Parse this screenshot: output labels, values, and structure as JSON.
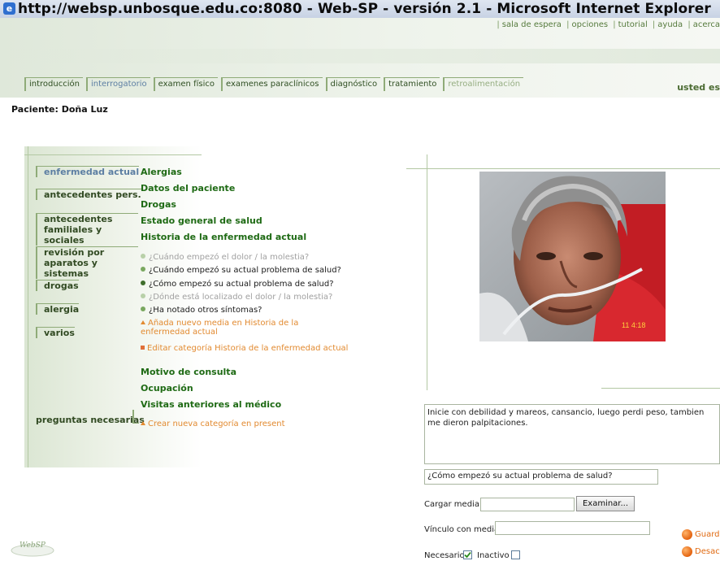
{
  "window": {
    "title": "http://websp.unbosque.edu.co:8080 - Web-SP - versión 2.1 - Microsoft Internet Explorer"
  },
  "topnav": [
    "sala de espera",
    "opciones",
    "tutorial",
    "ayuda",
    "acerca"
  ],
  "tabs": [
    {
      "label": "introducción",
      "state": "normal"
    },
    {
      "label": "interrogatorio",
      "state": "active"
    },
    {
      "label": "examen físico",
      "state": "normal"
    },
    {
      "label": "examenes paraclínicos",
      "state": "normal"
    },
    {
      "label": "diagnóstico",
      "state": "normal"
    },
    {
      "label": "tratamiento",
      "state": "normal"
    },
    {
      "label": "retroalimentación",
      "state": "dim"
    }
  ],
  "user_text": "usted es",
  "patient": "Paciente: Doña Luz",
  "sidebar": [
    {
      "label": "enfermedad actual",
      "active": true
    },
    {
      "label": "antecedentes pers."
    },
    {
      "label": "antecedentes familiales y sociales"
    },
    {
      "label": "revisión por aparatos y sistemas"
    },
    {
      "label": "drogas"
    },
    {
      "label": "alergia"
    },
    {
      "label": "varios"
    }
  ],
  "preguntas_label": "preguntas necesarias",
  "categories_top": [
    "Alergias",
    "Datos del paciente",
    "Drogas",
    "Estado general de salud",
    "Historia de la enfermedad actual"
  ],
  "questions": [
    {
      "text": "¿Cuándo empezó el dolor / la molestia?",
      "status": "inactive"
    },
    {
      "text": "¿Cuándo empezó su actual problema de salud?",
      "status": "done"
    },
    {
      "text": "¿Cómo empezó su actual problema de salud?",
      "status": "selected"
    },
    {
      "text": "¿Dónde está localizado el dolor / la molestia?",
      "status": "inactive"
    },
    {
      "text": "¿Ha notado otros síntomas?",
      "status": "done"
    }
  ],
  "actions": {
    "add_media": "Añada nuevo media en Historia de la enfermedad actual",
    "edit_category": "Editar categoría Historia de la enfermedad actual",
    "create_category": "Crear nueva categoría en present"
  },
  "categories_bottom": [
    "Motivo de consulta",
    "Ocupación",
    "Visitas anteriores al médico"
  ],
  "photo": {
    "timestamp": "11 4:18"
  },
  "form": {
    "answer": "Inicie con debilidad y mareos, cansancio, luego perdi peso, tambien me dieron palpitaciones.",
    "question": "¿Cómo empezó su actual problema de salud?",
    "cargar_label": "Cargar media:",
    "examinar": "Examinar...",
    "vinculo_label": "Vínculo con media:",
    "necesario_label": "Necesario",
    "inactivo_label": "Inactivo",
    "necesario_checked": true,
    "inactivo_checked": false,
    "guardar": "Guarda",
    "desactivar": "Desact"
  },
  "logo": "WebSP",
  "colors": {
    "header_green": "#dfe8da",
    "category_green": "#1e6a14",
    "action_orange": "#e28a30",
    "active_blue": "#5d7fa3"
  }
}
